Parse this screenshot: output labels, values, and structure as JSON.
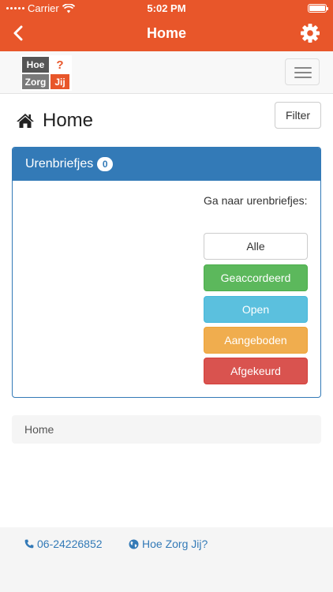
{
  "status_bar": {
    "carrier": "Carrier",
    "time": "5:02 PM"
  },
  "app_bar": {
    "title": "Home"
  },
  "logo": {
    "word1": "Hoe",
    "mark": "?",
    "word2": "Zorg",
    "word3": "Jij"
  },
  "page": {
    "title": "Home",
    "filter_label": "Filter"
  },
  "panel": {
    "heading": "Urenbriefjes",
    "count": "0",
    "goto_label": "Ga naar urenbriefjes:",
    "buttons": {
      "alle": "Alle",
      "geaccordeerd": "Geaccordeerd",
      "open": "Open",
      "aangeboden": "Aangeboden",
      "afgekeurd": "Afgekeurd"
    }
  },
  "breadcrumb": {
    "current": "Home"
  },
  "footer": {
    "phone": "06-24226852",
    "site": "Hoe Zorg Jij?"
  },
  "colors": {
    "brand_orange": "#e8562a",
    "primary_blue": "#337ab7",
    "success": "#5cb85c",
    "info": "#5bc0de",
    "warning": "#f0ad4e",
    "danger": "#d9534f"
  }
}
